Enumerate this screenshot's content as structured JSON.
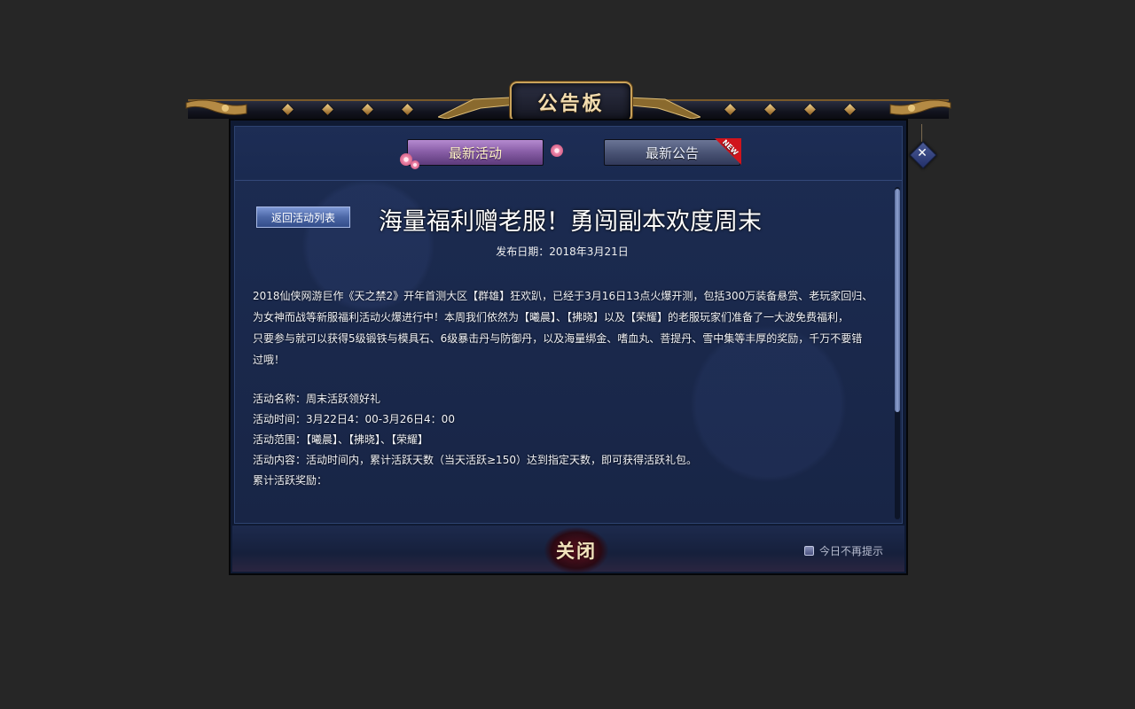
{
  "dialog": {
    "title": "公告板",
    "close_x": "✕"
  },
  "tabs": [
    {
      "label": "最新活动",
      "active": true
    },
    {
      "label": "最新公告",
      "badge": "NEW"
    }
  ],
  "article": {
    "back_label": "返回活动列表",
    "title": "海量福利赠老服！勇闯副本欢度周末",
    "publish_date": "发布日期：2018年3月21日",
    "intro_lines": [
      "2018仙侠网游巨作《天之禁2》开年首测大区【群雄】狂欢趴，已经于3月16日13点火爆开测，包括300万装备悬赏、老玩家回归、",
      "为女神而战等新服福利活动火爆进行中！本周我们依然为【曦晨】、【拂晓】以及【荣耀】的老服玩家们准备了一大波免费福利，",
      "只要参与就可以获得5级锻铁与模具石、6级暴击丹与防御丹，以及海量绑金、嗜血丸、菩提丹、雪中集等丰厚的奖励，千万不要错",
      "过哦！"
    ],
    "details": [
      "活动名称：周末活跃领好礼",
      "活动时间：3月22日4：00-3月26日4：00",
      "活动范围：【曦晨】、【拂晓】、【荣耀】",
      "活动内容：活动时间内，累计活跃天数（当天活跃≥150）达到指定天数，即可获得活跃礼包。",
      "累计活跃奖励："
    ]
  },
  "footer": {
    "close_label": "关闭",
    "dont_remind_label": "今日不再提示",
    "dont_remind_checked": false
  },
  "colors": {
    "panel_bg": "#182546",
    "gold_trim": "#c9a25a",
    "new_badge": "#d0141c"
  }
}
